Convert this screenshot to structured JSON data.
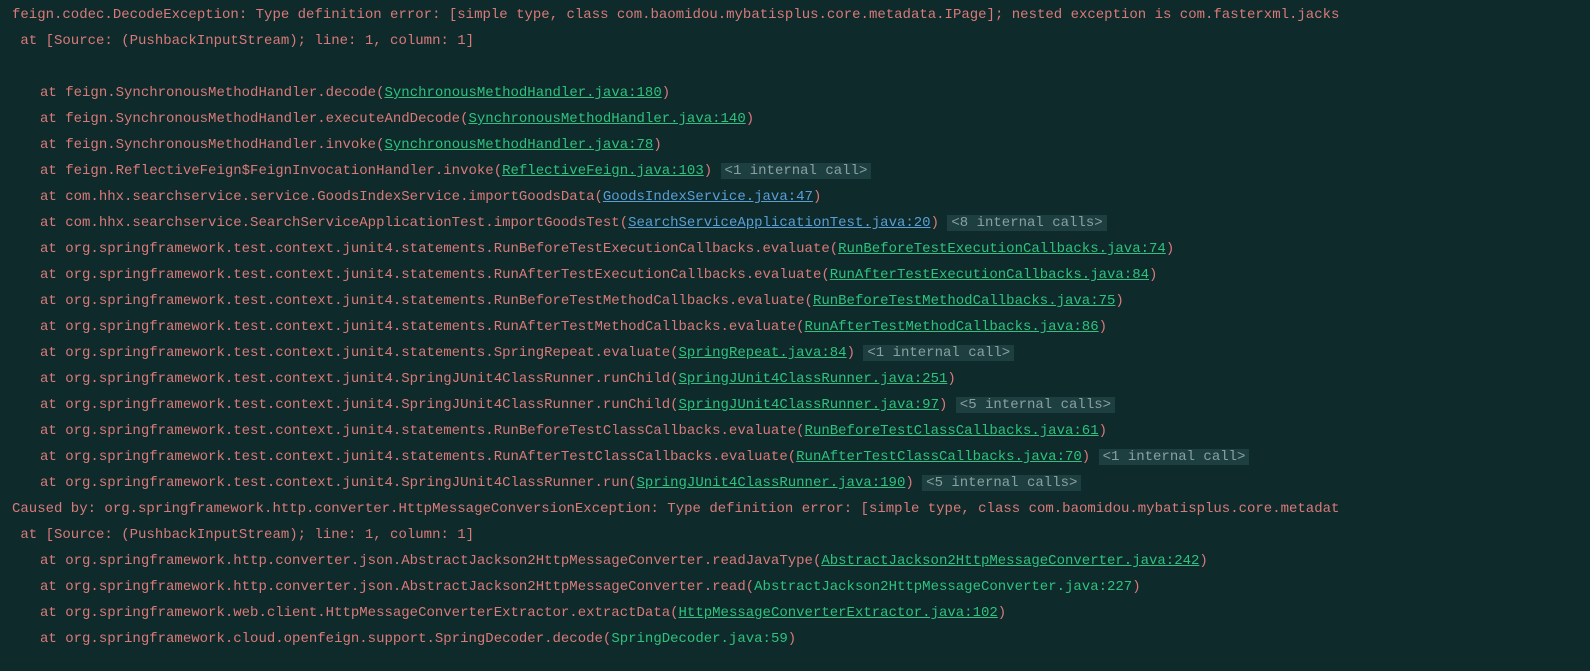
{
  "glyph": "",
  "header": {
    "l1": "feign.codec.DecodeException: Type definition error: [simple type, class com.baomidou.mybatisplus.core.metadata.IPage]; nested exception is com.fasterxml.jacks",
    "l2": " at [Source: (PushbackInputStream); line: 1, column: 1]"
  },
  "frames": [
    {
      "g": "",
      "pre": "feign.SynchronousMethodHandler.decode(",
      "link": "SynchronousMethodHandler.java:180",
      "link_type": "active",
      "post": ")",
      "tail": ""
    },
    {
      "g": "",
      "pre": "feign.SynchronousMethodHandler.executeAndDecode(",
      "link": "SynchronousMethodHandler.java:140",
      "link_type": "active",
      "post": ")",
      "tail": ""
    },
    {
      "g": "",
      "pre": "feign.SynchronousMethodHandler.invoke(",
      "link": "SynchronousMethodHandler.java:78",
      "link_type": "active",
      "post": ")",
      "tail": ""
    },
    {
      "g": "g",
      "pre": "feign.ReflectiveFeign$FeignInvocationHandler.invoke(",
      "link": "ReflectiveFeign.java:103",
      "link_type": "active",
      "post": ")",
      "tail": " <1 internal call>"
    },
    {
      "g": "",
      "pre": "com.hhx.searchservice.service.GoodsIndexService.importGoodsData(",
      "link": "GoodsIndexService.java:47",
      "link_type": "blue",
      "post": ")",
      "tail": ""
    },
    {
      "g": "g",
      "pre": "com.hhx.searchservice.SearchServiceApplicationTest.importGoodsTest(",
      "link": "SearchServiceApplicationTest.java:20",
      "link_type": "blue",
      "post": ")",
      "tail": " <8 internal calls>"
    },
    {
      "g": "",
      "pre": "org.springframework.test.context.junit4.statements.RunBeforeTestExecutionCallbacks.evaluate(",
      "link": "RunBeforeTestExecutionCallbacks.java:74",
      "link_type": "active",
      "post": ")",
      "tail": ""
    },
    {
      "g": "",
      "pre": "org.springframework.test.context.junit4.statements.RunAfterTestExecutionCallbacks.evaluate(",
      "link": "RunAfterTestExecutionCallbacks.java:84",
      "link_type": "active",
      "post": ")",
      "tail": ""
    },
    {
      "g": "",
      "pre": "org.springframework.test.context.junit4.statements.RunBeforeTestMethodCallbacks.evaluate(",
      "link": "RunBeforeTestMethodCallbacks.java:75",
      "link_type": "active",
      "post": ")",
      "tail": ""
    },
    {
      "g": "",
      "pre": "org.springframework.test.context.junit4.statements.RunAfterTestMethodCallbacks.evaluate(",
      "link": "RunAfterTestMethodCallbacks.java:86",
      "link_type": "active",
      "post": ")",
      "tail": ""
    },
    {
      "g": "g",
      "pre": "org.springframework.test.context.junit4.statements.SpringRepeat.evaluate(",
      "link": "SpringRepeat.java:84",
      "link_type": "active",
      "post": ")",
      "tail": " <1 internal call>"
    },
    {
      "g": "",
      "pre": "org.springframework.test.context.junit4.SpringJUnit4ClassRunner.runChild(",
      "link": "SpringJUnit4ClassRunner.java:251",
      "link_type": "active",
      "post": ")",
      "tail": ""
    },
    {
      "g": "g",
      "pre": "org.springframework.test.context.junit4.SpringJUnit4ClassRunner.runChild(",
      "link": "SpringJUnit4ClassRunner.java:97",
      "link_type": "active",
      "post": ")",
      "tail": " <5 internal calls>"
    },
    {
      "g": "",
      "pre": "org.springframework.test.context.junit4.statements.RunBeforeTestClassCallbacks.evaluate(",
      "link": "RunBeforeTestClassCallbacks.java:61",
      "link_type": "active",
      "post": ")",
      "tail": ""
    },
    {
      "g": "g",
      "pre": "org.springframework.test.context.junit4.statements.RunAfterTestClassCallbacks.evaluate(",
      "link": "RunAfterTestClassCallbacks.java:70",
      "link_type": "active",
      "post": ")",
      "tail": " <1 internal call>"
    },
    {
      "g": "g",
      "pre": "org.springframework.test.context.junit4.SpringJUnit4ClassRunner.run(",
      "link": "SpringJUnit4ClassRunner.java:190",
      "link_type": "active",
      "post": ")",
      "tail": " <5 internal calls>"
    }
  ],
  "caused": {
    "l1": "Caused by: org.springframework.http.converter.HttpMessageConversionException: Type definition error: [simple type, class com.baomidou.mybatisplus.core.metadat",
    "l2": " at [Source: (PushbackInputStream); line: 1, column: 1]"
  },
  "frames2": [
    {
      "g": "",
      "pre": "org.springframework.http.converter.json.AbstractJackson2HttpMessageConverter.readJavaType(",
      "link": "AbstractJackson2HttpMessageConverter.java:242",
      "link_type": "active",
      "post": ")",
      "tail": ""
    },
    {
      "g": "",
      "pre": "org.springframework.http.converter.json.AbstractJackson2HttpMessageConverter.read(",
      "link": "AbstractJackson2HttpMessageConverter.java:227",
      "link_type": "inactive",
      "post": ")",
      "tail": ""
    },
    {
      "g": "",
      "pre": "org.springframework.web.client.HttpMessageConverterExtractor.extractData(",
      "link": "HttpMessageConverterExtractor.java:102",
      "link_type": "active",
      "post": ")",
      "tail": ""
    },
    {
      "g": "",
      "pre": "org.springframework.cloud.openfeign.support.SpringDecoder.decode(",
      "link": "SpringDecoder.java:59",
      "link_type": "inactive",
      "post": ")",
      "tail": ""
    }
  ],
  "at_word": "at "
}
